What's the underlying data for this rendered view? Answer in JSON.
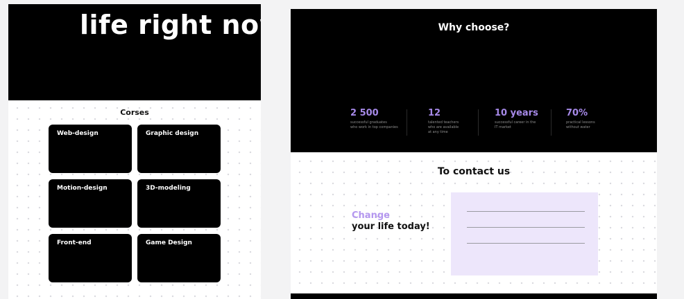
{
  "left": {
    "hero_title": "life right now",
    "courses_title": "Corses",
    "courses": [
      {
        "label": "Web-design"
      },
      {
        "label": "Graphic design"
      },
      {
        "label": "Motion-design"
      },
      {
        "label": "3D-modeling"
      },
      {
        "label": "Front-end"
      },
      {
        "label": "Game Design"
      }
    ]
  },
  "right": {
    "why_title": "Why choose?",
    "stats": [
      {
        "value": "2 500",
        "caption": "successful graduates\nwho work in top companies"
      },
      {
        "value": "12",
        "caption": "talented teachers\nwho are available\nat any time"
      },
      {
        "value": "10 years",
        "caption": "successful career in the\nIT market"
      },
      {
        "value": "70%",
        "caption": "practical lessons\nwithout water"
      }
    ],
    "contact_title": "To contact us",
    "cta_accent": "Change",
    "cta_main": "your life today!"
  },
  "colors": {
    "accent": "#a689e8",
    "form_bg": "#ede6fb",
    "card_bg": "#000000"
  }
}
